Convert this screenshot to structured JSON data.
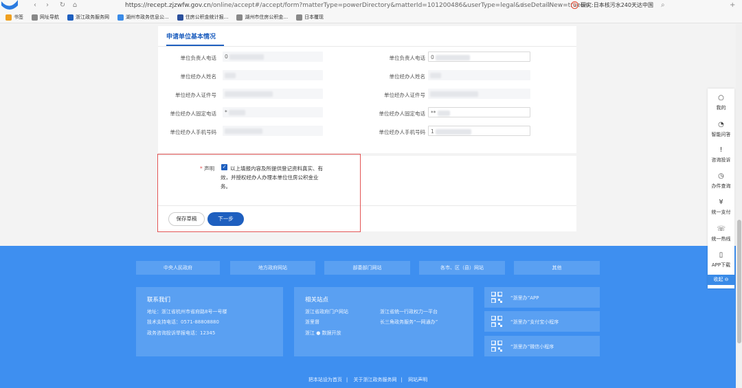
{
  "browser": {
    "url_main": "https://recept.zjzwfw.gov.cn",
    "url_rest": "/online/accept#/accept/form?matterType=powerDirectory&matterId=101200486&userType=legal&useDetailNew=true&u",
    "search_text": "研究:日本核污水240天达中国",
    "search_badge": "S",
    "nav_back": "‹",
    "nav_forward": "›",
    "nav_refresh": "↻",
    "nav_home": "⌂"
  },
  "bookmarks": [
    {
      "label": "书签",
      "color": "#f0a020"
    },
    {
      "label": "网址导航",
      "color": "#888888"
    },
    {
      "label": "浙江政务服务网",
      "color": "#1e5fbf"
    },
    {
      "label": "湖州市政务信息公...",
      "color": "#3a8be8"
    },
    {
      "label": "住房公积金统计报...",
      "color": "#2a4f9c"
    },
    {
      "label": "湖州市住房公积金...",
      "color": "#888888"
    },
    {
      "label": "日本覆现",
      "color": "#888888"
    }
  ],
  "form": {
    "section_title": "申请单位基本情况",
    "left_fields": [
      {
        "label": "单位负责人电话",
        "value": "0"
      },
      {
        "label": "单位经办人姓名",
        "value": ""
      },
      {
        "label": "单位经办人证件号",
        "value": ""
      },
      {
        "label": "单位经办人固定电话",
        "value": "*"
      },
      {
        "label": "单位经办人手机号码",
        "value": ""
      }
    ],
    "right_fields": [
      {
        "label": "单位负责人电话",
        "value": "0"
      },
      {
        "label": "单位经办人姓名",
        "value": ""
      },
      {
        "label": "单位经办人证件号",
        "value": ""
      },
      {
        "label": "单位经办人固定电话",
        "value": "**"
      },
      {
        "label": "单位经办人手机号码",
        "value": "1"
      }
    ]
  },
  "declaration": {
    "required_mark": "*",
    "label": "声明",
    "text": "以上填报内容及所提供登记资料真实、有效，并授权经办人办理本单位住房公积金业务。",
    "check": "✓"
  },
  "buttons": {
    "save": "保存草稿",
    "next": "下一步"
  },
  "side_panel": {
    "items": [
      {
        "icon": "○",
        "label": "我的"
      },
      {
        "icon": "◔",
        "label": "智能问答"
      },
      {
        "icon": "!",
        "label": "咨询投诉"
      },
      {
        "icon": "◷",
        "label": "办件查询"
      },
      {
        "icon": "¥",
        "label": "统一支付"
      },
      {
        "icon": "☏",
        "label": "统一热线"
      },
      {
        "icon": "▯",
        "label": "APP下载"
      }
    ],
    "collapse": "收起 ⊖"
  },
  "footer": {
    "links": [
      "中央人民政府",
      "地方政府网站",
      "部委部门网站",
      "各市、区（县）网站",
      "其他"
    ],
    "contact_title": "联系我们",
    "contact_lines": [
      "地址：浙江省杭州市省府路8号一号楼",
      "技术支持电话：0571-88808880",
      "政务咨询投诉举报电话：12345"
    ],
    "related_title": "相关站点",
    "related_col1": [
      "浙江省政府门户网站",
      "浙里督",
      "浙江 ● 数据开放"
    ],
    "related_col2": [
      "浙江省统一行政权力一平台",
      "长三角政务服务“一网通办”"
    ],
    "apps": [
      "“浙里办”APP",
      "“浙里办”支付宝小程序",
      "“浙里办”微信小程序"
    ],
    "bottom_links": [
      "把本站设为首页",
      "关于浙江政务服务网",
      "网站声明"
    ]
  }
}
